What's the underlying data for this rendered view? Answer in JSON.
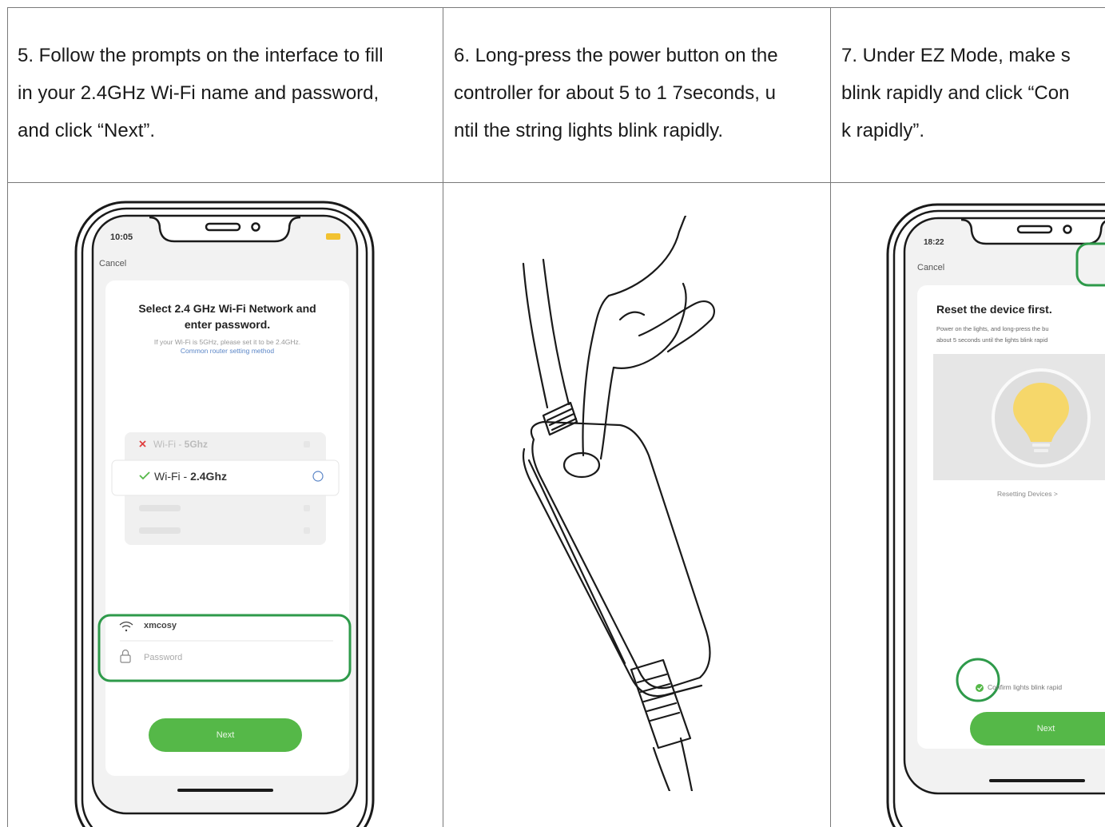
{
  "steps": [
    {
      "lines": [
        "5. Follow the prompts on the interface to fill",
        "in your 2.4GHz Wi-Fi name and password,",
        "and click “Next”."
      ]
    },
    {
      "lines": [
        "6. Long-press the power button on the",
        "controller for about 5 to 1 7seconds, u",
        "ntil the string lights blink rapidly."
      ]
    },
    {
      "lines": [
        "7. Under EZ Mode, make s",
        "blink rapidly and click “Con",
        "k rapidly”."
      ]
    }
  ],
  "phone1": {
    "time": "10:05",
    "cancel": "Cancel",
    "title_line1": "Select 2.4 GHz Wi-Fi Network and",
    "title_line2": "enter password.",
    "hint_line1": "If your Wi-Fi is 5GHz, please set it to be 2.4GHz.",
    "hint_link": "Common router setting method",
    "wifi_5g_prefix": "Wi-Fi - ",
    "wifi_5g_band": "5Ghz",
    "wifi_24_prefix": "Wi-Fi - ",
    "wifi_24_band": "2.4Ghz",
    "ssid_value": "xmcosy",
    "password_placeholder": "Password",
    "next_label": "Next"
  },
  "phone3": {
    "time": "18:22",
    "cancel": "Cancel",
    "title": "Reset the device first.",
    "desc_line1": "Power on the lights, and long-press the bu",
    "desc_line2": "about 5 seconds until the lights blink rapid",
    "resetting_link": "Resetting Devices >",
    "confirm_label": "Confirm lights blink rapid",
    "next_label": "Next"
  },
  "colors": {
    "accent_green": "#55b848",
    "highlight_green": "#2e9a4a",
    "error_red": "#e04040",
    "link_blue": "#5b86c7"
  }
}
